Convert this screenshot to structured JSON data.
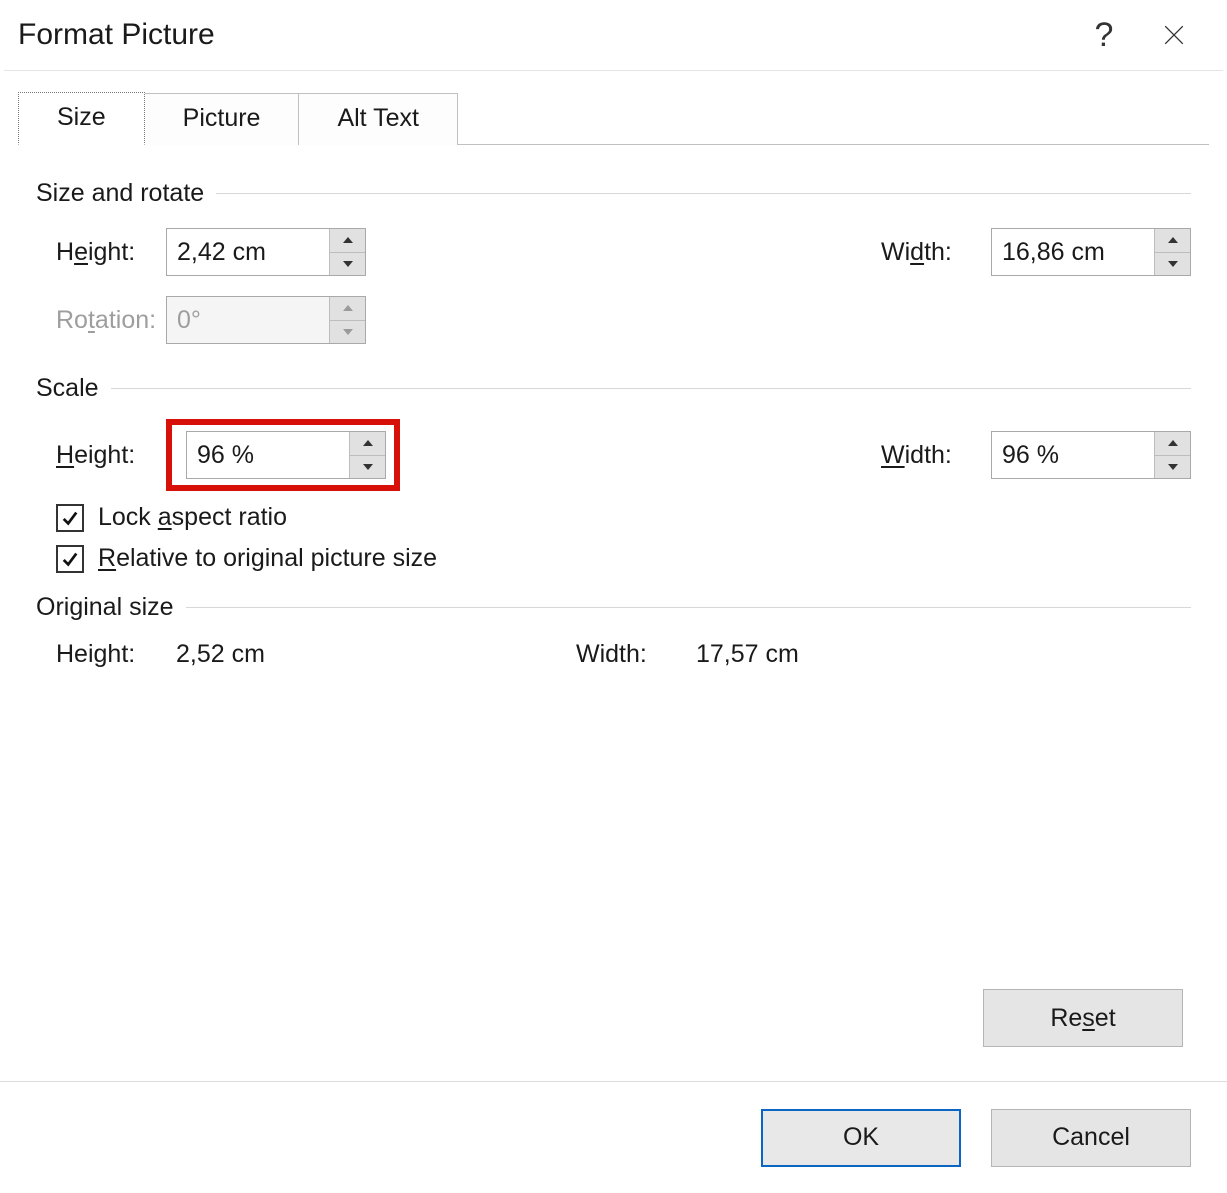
{
  "dialog": {
    "title": "Format Picture",
    "help_tooltip": "?",
    "tabs": [
      "Size",
      "Picture",
      "Alt Text"
    ],
    "active_tab": 0
  },
  "size_and_rotate": {
    "section_label": "Size and rotate",
    "height_label_pre": "H",
    "height_label_ul": "e",
    "height_label_post": "ight:",
    "height_value": "2,42 cm",
    "width_label_pre": "Wi",
    "width_label_ul": "d",
    "width_label_post": "th:",
    "width_value": "16,86 cm",
    "rotation_label_pre": "Ro",
    "rotation_label_ul": "t",
    "rotation_label_post": "ation:",
    "rotation_value": "0°",
    "rotation_disabled": true
  },
  "scale": {
    "section_label": "Scale",
    "height_label_ul": "H",
    "height_label_post": "eight:",
    "height_value": "96 %",
    "height_highlighted": true,
    "width_label_ul": "W",
    "width_label_post": "idth:",
    "width_value": "96 %",
    "lock_aspect": {
      "checked": true,
      "label_pre": "Lock ",
      "label_ul": "a",
      "label_post": "spect ratio"
    },
    "relative_original": {
      "checked": true,
      "label_ul": "R",
      "label_post": "elative to original picture size"
    }
  },
  "original_size": {
    "section_label": "Original size",
    "height_label": "Height:",
    "height_value": "2,52 cm",
    "width_label": "Width:",
    "width_value": "17,57 cm"
  },
  "buttons": {
    "reset_pre": "Re",
    "reset_ul": "s",
    "reset_post": "et",
    "ok": "OK",
    "cancel": "Cancel"
  }
}
